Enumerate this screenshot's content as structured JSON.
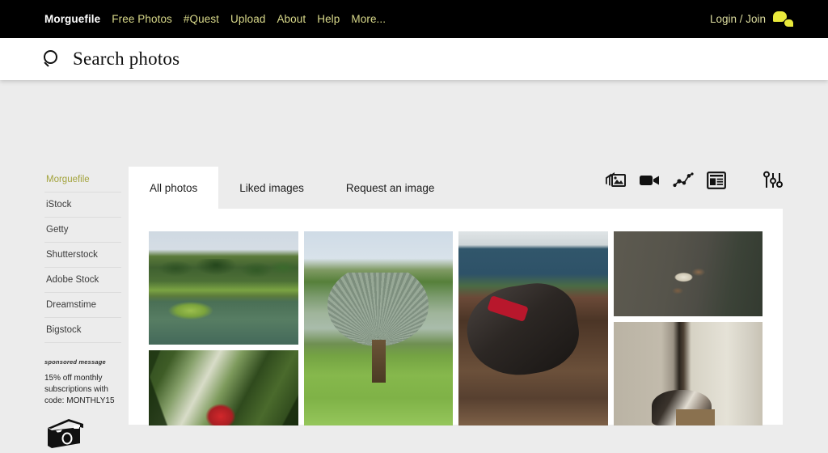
{
  "topnav": {
    "links": [
      {
        "label": "Morguefile",
        "brand": true
      },
      {
        "label": "Free Photos",
        "brand": false
      },
      {
        "label": "#Quest",
        "brand": false
      },
      {
        "label": "Upload",
        "brand": false
      },
      {
        "label": "About",
        "brand": false
      },
      {
        "label": "Help",
        "brand": false
      },
      {
        "label": "More...",
        "brand": false
      }
    ],
    "login_label": "Login / Join",
    "chat_icon": "chat-bubbles-icon",
    "background_color": "#000000",
    "link_color": "#d9d98a",
    "accent_color": "#e9e93b"
  },
  "search": {
    "icon": "search-icon",
    "value": "",
    "placeholder": "Search photos"
  },
  "sidebar": {
    "items": [
      {
        "label": "Morguefile",
        "active": true
      },
      {
        "label": "iStock",
        "active": false
      },
      {
        "label": "Getty",
        "active": false
      },
      {
        "label": "Shutterstock",
        "active": false
      },
      {
        "label": "Adobe Stock",
        "active": false
      },
      {
        "label": "Dreamstime",
        "active": false
      },
      {
        "label": "Bigstock",
        "active": false
      }
    ],
    "active_color": "#a3a33c",
    "sponsored": {
      "label": "sponsored message",
      "text": "15% off monthly subscriptions with code: MONTHLY15",
      "icon": "camera-icon"
    }
  },
  "tabs": [
    {
      "label": "All photos",
      "active": true
    },
    {
      "label": "Liked images",
      "active": false
    },
    {
      "label": "Request an image",
      "active": false
    }
  ],
  "toolbar": {
    "icons": [
      {
        "name": "photos-icon",
        "label": "Photos"
      },
      {
        "name": "video-camera-icon",
        "label": "Videos"
      },
      {
        "name": "graph-icon",
        "label": "Graphs"
      },
      {
        "name": "article-layout-icon",
        "label": "Articles"
      },
      {
        "name": "sliders-filter-icon",
        "label": "Filters"
      }
    ]
  },
  "gallery": {
    "columns": [
      {
        "photos": [
          {
            "name": "photo-pond-jungle",
            "alt": "Tropical pond with jungle vegetation"
          },
          {
            "name": "photo-red-torch-ginger",
            "alt": "Red torch ginger flower among leaves"
          }
        ]
      },
      {
        "photos": [
          {
            "name": "photo-fan-palm",
            "alt": "Silver fan palm tree on lawn"
          }
        ]
      },
      {
        "photos": [
          {
            "name": "photo-pig-in-mud",
            "alt": "Black pig with red collar digging in mud"
          }
        ]
      },
      {
        "photos": [
          {
            "name": "photo-crab-on-sand",
            "alt": "Crab on wet sand"
          },
          {
            "name": "photo-dog-by-wall",
            "alt": "Dog lying near a wall corner"
          }
        ]
      }
    ]
  },
  "page": {
    "background_color": "#ececec",
    "card_color": "#ffffff"
  }
}
